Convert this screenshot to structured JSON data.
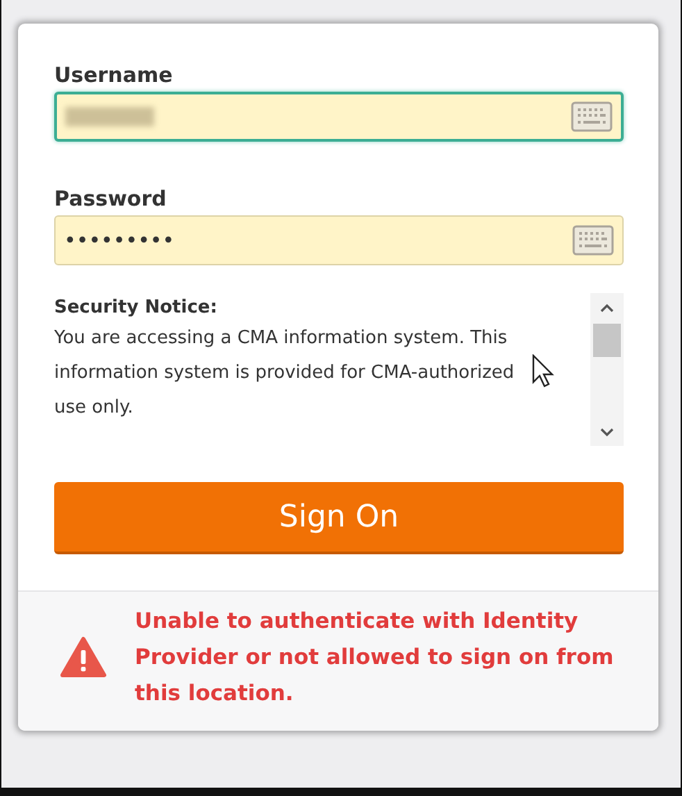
{
  "form": {
    "username": {
      "label": "Username"
    },
    "password": {
      "label": "Password",
      "value": "•••••••••"
    },
    "security_notice": {
      "title": "Security Notice:",
      "text": "You are accessing a CMA information system. This information system is provided for CMA-authorized use only."
    },
    "submit": {
      "label": "Sign On"
    }
  },
  "error": {
    "message": "Unable to authenticate with Identity Provider or not allowed to sign on from this location."
  }
}
